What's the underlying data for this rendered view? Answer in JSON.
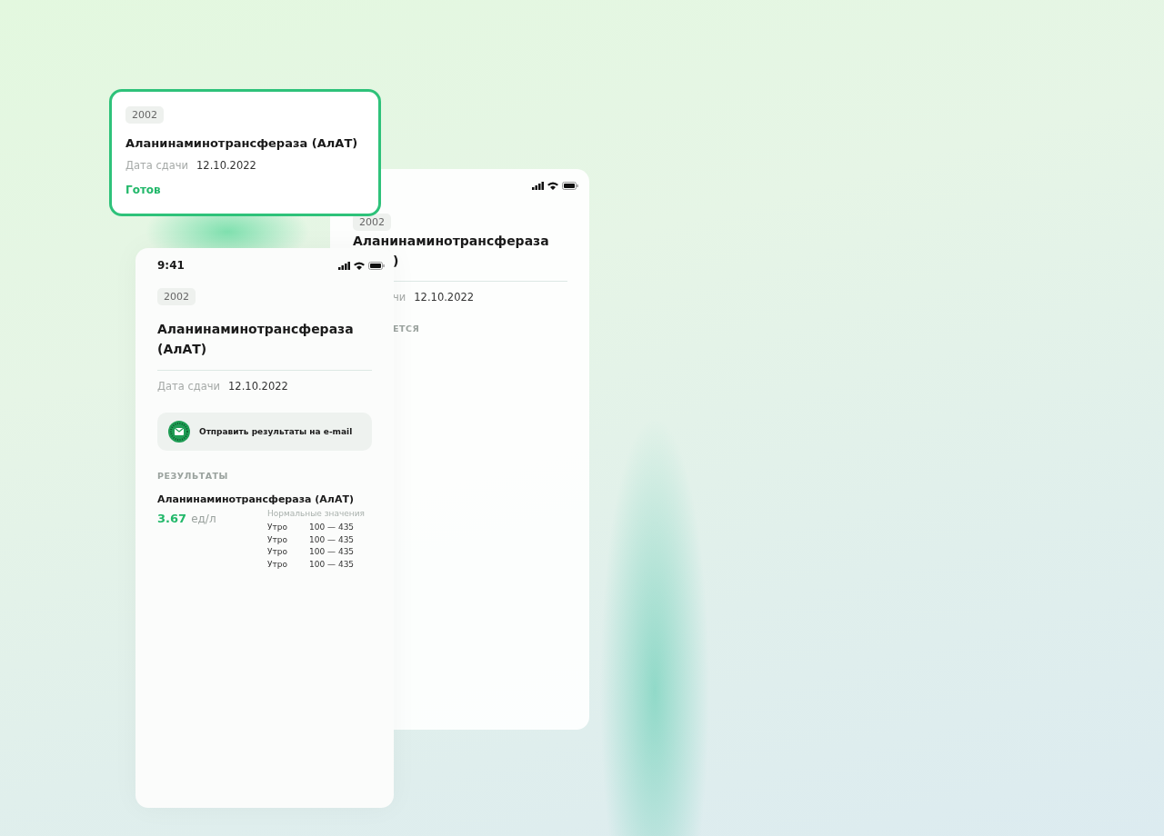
{
  "back_phone": {
    "tag": "2002",
    "title_visible": "Аланинаминотрансфераза",
    "title_end": ")",
    "date_label_visible": "чи",
    "date": "12.10.2022",
    "status_visible": "ЕТСЯ"
  },
  "card": {
    "tag": "2002",
    "title": "Аланинаминотрансфераза (АлАТ)",
    "date_label": "Дата сдачи",
    "date": "12.10.2022",
    "status": "Готов",
    "selected": true
  },
  "front_phone": {
    "time": "9:41",
    "tag": "2002",
    "title": "Аланинаминотрансфераза (АлАТ)",
    "date_label": "Дата сдачи",
    "date": "12.10.2022",
    "email_button": "Отправить результаты на e-mail",
    "results_heading": "РЕЗУЛЬТАТЫ",
    "result_name": "Аланинаминотрансфераза (АлАТ)",
    "result_value": "3.67",
    "result_unit": "ед/л",
    "norms_heading": "Нормальные значения",
    "norms": [
      {
        "period": "Утро",
        "range": "100 — 435"
      },
      {
        "period": "Утро",
        "range": "100 — 435"
      },
      {
        "period": "Утро",
        "range": "100 — 435"
      },
      {
        "period": "Утро",
        "range": "100 — 435"
      }
    ]
  }
}
